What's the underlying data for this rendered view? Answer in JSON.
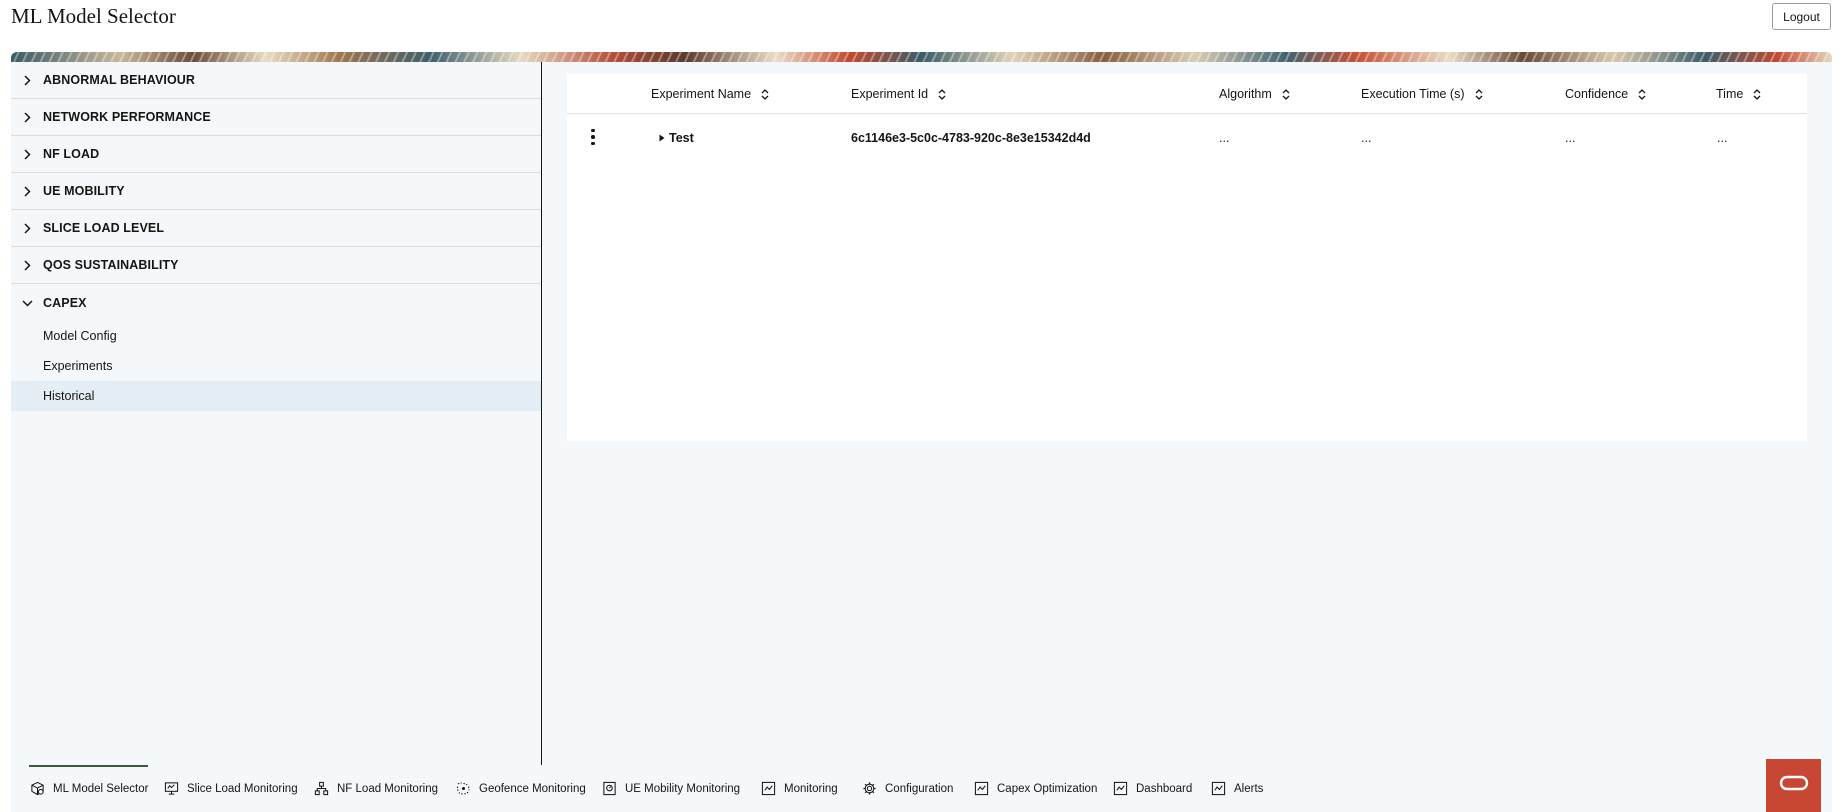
{
  "app": {
    "title": "ML Model Selector",
    "logout_label": "Logout"
  },
  "sidebar": {
    "items": [
      {
        "label": "ABNORMAL BEHAVIOUR"
      },
      {
        "label": "NETWORK PERFORMANCE"
      },
      {
        "label": "NF LOAD"
      },
      {
        "label": "UE MOBILITY"
      },
      {
        "label": "SLICE LOAD LEVEL"
      },
      {
        "label": "QOS SUSTAINABILITY"
      },
      {
        "label": "CAPEX",
        "expanded": true
      }
    ],
    "capex_children": [
      {
        "label": "Model Config"
      },
      {
        "label": "Experiments"
      },
      {
        "label": "Historical",
        "selected": true
      }
    ]
  },
  "table": {
    "columns": [
      "Experiment Name",
      "Experiment Id",
      "Algorithm",
      "Execution Time (s)",
      "Confidence",
      "Time"
    ],
    "rows": [
      {
        "name": "Test",
        "id": "6c1146e3-5c0c-4783-920c-8e3e15342d4d",
        "algorithm": "...",
        "execution_time": "...",
        "confidence": "...",
        "time": "..."
      }
    ]
  },
  "footer": {
    "tabs": [
      {
        "label": "ML Model Selector",
        "icon": "model-selector-icon",
        "active": true
      },
      {
        "label": "Slice Load Monitoring",
        "icon": "monitor-icon"
      },
      {
        "label": "NF Load Monitoring",
        "icon": "hierarchy-icon"
      },
      {
        "label": "Geofence Monitoring",
        "icon": "geofence-icon"
      },
      {
        "label": "UE Mobility Monitoring",
        "icon": "mobility-icon"
      },
      {
        "label": "Monitoring",
        "icon": "chart-icon"
      },
      {
        "label": "Configuration",
        "icon": "gear-icon"
      },
      {
        "label": "Capex Optimization",
        "icon": "chart-icon"
      },
      {
        "label": "Dashboard",
        "icon": "chart-icon"
      },
      {
        "label": "Alerts",
        "icon": "chart-icon"
      }
    ]
  },
  "colors": {
    "accent_red": "#c74634",
    "selected_bg": "#e4eef4",
    "panel_bg": "#f5f8fa",
    "active_tab_line": "#3a5a3a"
  }
}
